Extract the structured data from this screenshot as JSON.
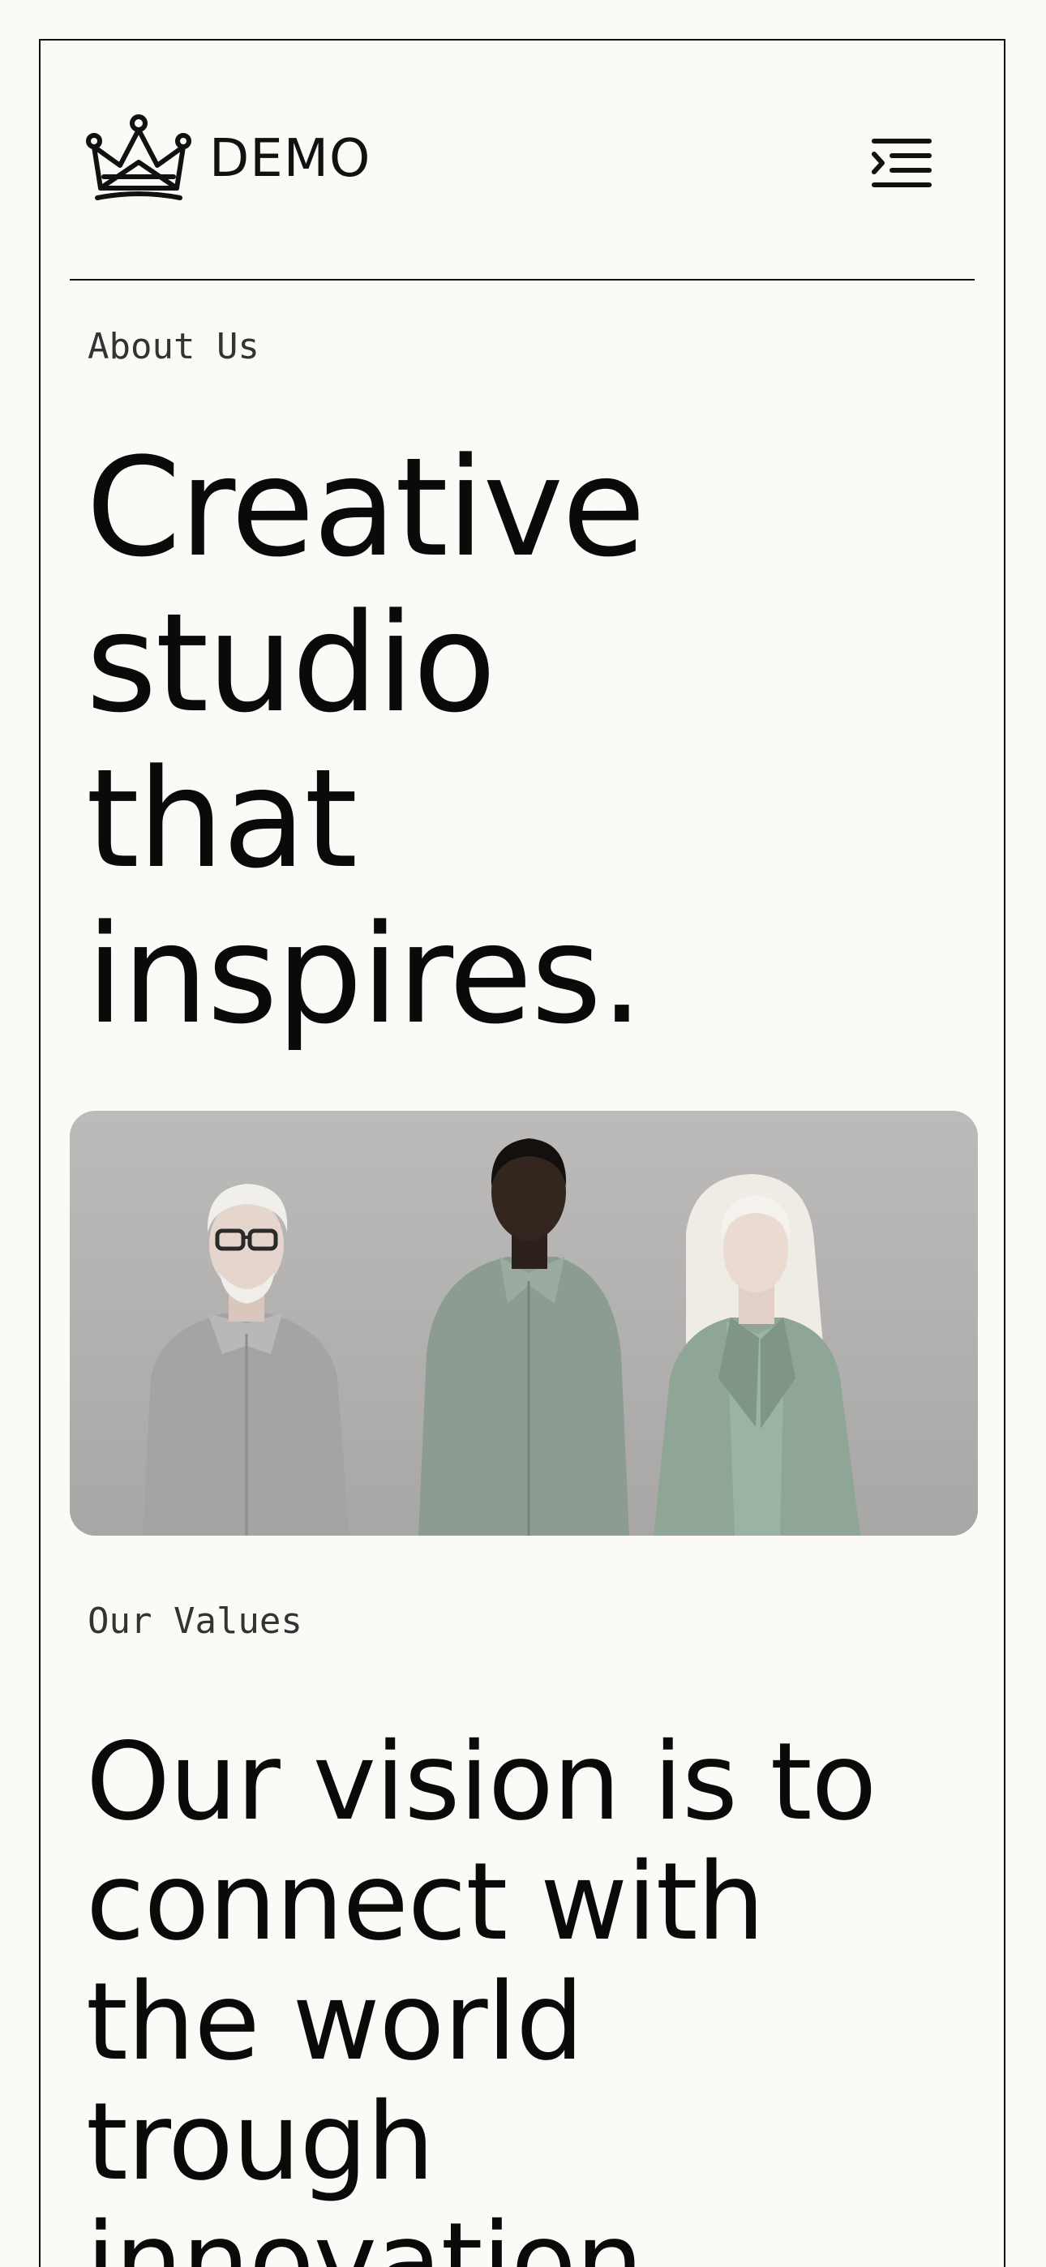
{
  "brand": {
    "logo_icon": "crown-icon",
    "name": "DEMO"
  },
  "header": {
    "menu_icon": "menu-indent-icon"
  },
  "about": {
    "eyebrow": "About Us",
    "title": "Creative\nstudio\nthat\ninspires."
  },
  "image": {
    "alt": "Three people standing against a grey wall wearing muted green and grey clothing"
  },
  "values": {
    "eyebrow": "Our Values",
    "title": "Our vision is to\nconnect with\nthe world\ntrough\ninnovation."
  },
  "colors": {
    "background": "#fbfaf6",
    "text": "#0a0a0a",
    "photo_backdrop": "#b3b1b0"
  }
}
